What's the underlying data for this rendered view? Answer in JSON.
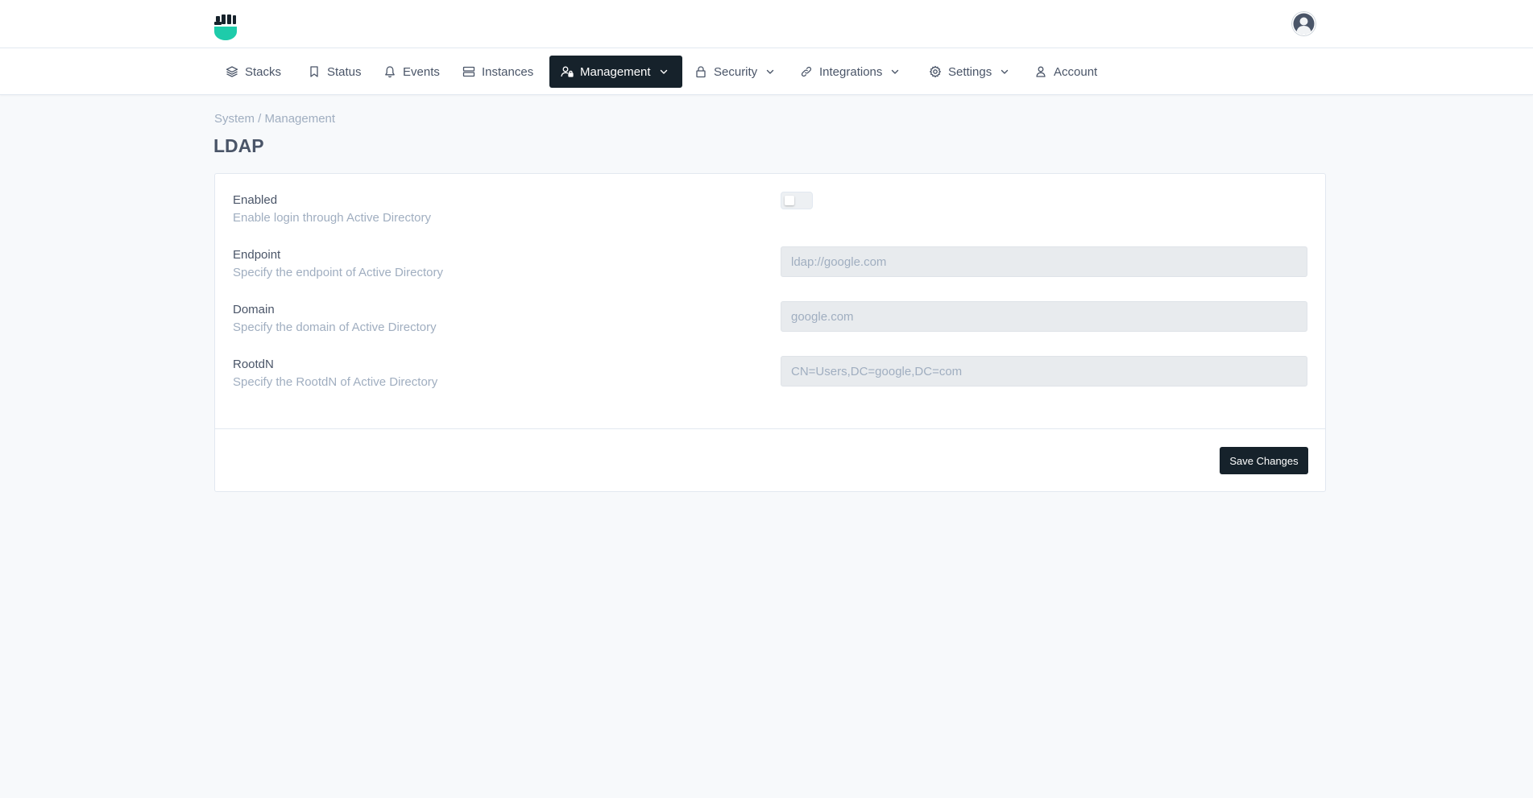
{
  "header": {
    "logo_icon": "shield-fist-logo-icon",
    "avatar_icon": "user-avatar-icon",
    "brand_color": "#1ecbaa"
  },
  "nav": {
    "items": [
      {
        "label": "Stacks",
        "icon": "stack-layers-icon",
        "has_dropdown": false,
        "active": false
      },
      {
        "label": "Status",
        "icon": "bookmark-icon",
        "has_dropdown": false,
        "active": false
      },
      {
        "label": "Events",
        "icon": "bell-icon",
        "has_dropdown": false,
        "active": false
      },
      {
        "label": "Instances",
        "icon": "server-icon",
        "has_dropdown": false,
        "active": false
      },
      {
        "label": "Management",
        "icon": "user-management-icon",
        "has_dropdown": true,
        "active": true
      },
      {
        "label": "Security",
        "icon": "lock-icon",
        "has_dropdown": true,
        "active": false
      },
      {
        "label": "Integrations",
        "icon": "link-icon",
        "has_dropdown": true,
        "active": false
      },
      {
        "label": "Settings",
        "icon": "gear-icon",
        "has_dropdown": true,
        "active": false
      },
      {
        "label": "Account",
        "icon": "user-icon",
        "has_dropdown": false,
        "active": false
      }
    ],
    "active_color": "#16222b"
  },
  "breadcrumb": "System / Management",
  "page_title": "LDAP",
  "form": {
    "enabled": {
      "label": "Enabled",
      "description": "Enable login through Active Directory",
      "value": false
    },
    "endpoint": {
      "label": "Endpoint",
      "description": "Specify the endpoint of Active Directory",
      "placeholder": "ldap://google.com",
      "value": ""
    },
    "domain": {
      "label": "Domain",
      "description": "Specify the domain of Active Directory",
      "placeholder": "google.com",
      "value": ""
    },
    "rootdn": {
      "label": "RootdN",
      "description": "Specify the RootdN of Active Directory",
      "placeholder": "CN=Users,DC=google,DC=com",
      "value": ""
    },
    "save_label": "Save Changes"
  }
}
